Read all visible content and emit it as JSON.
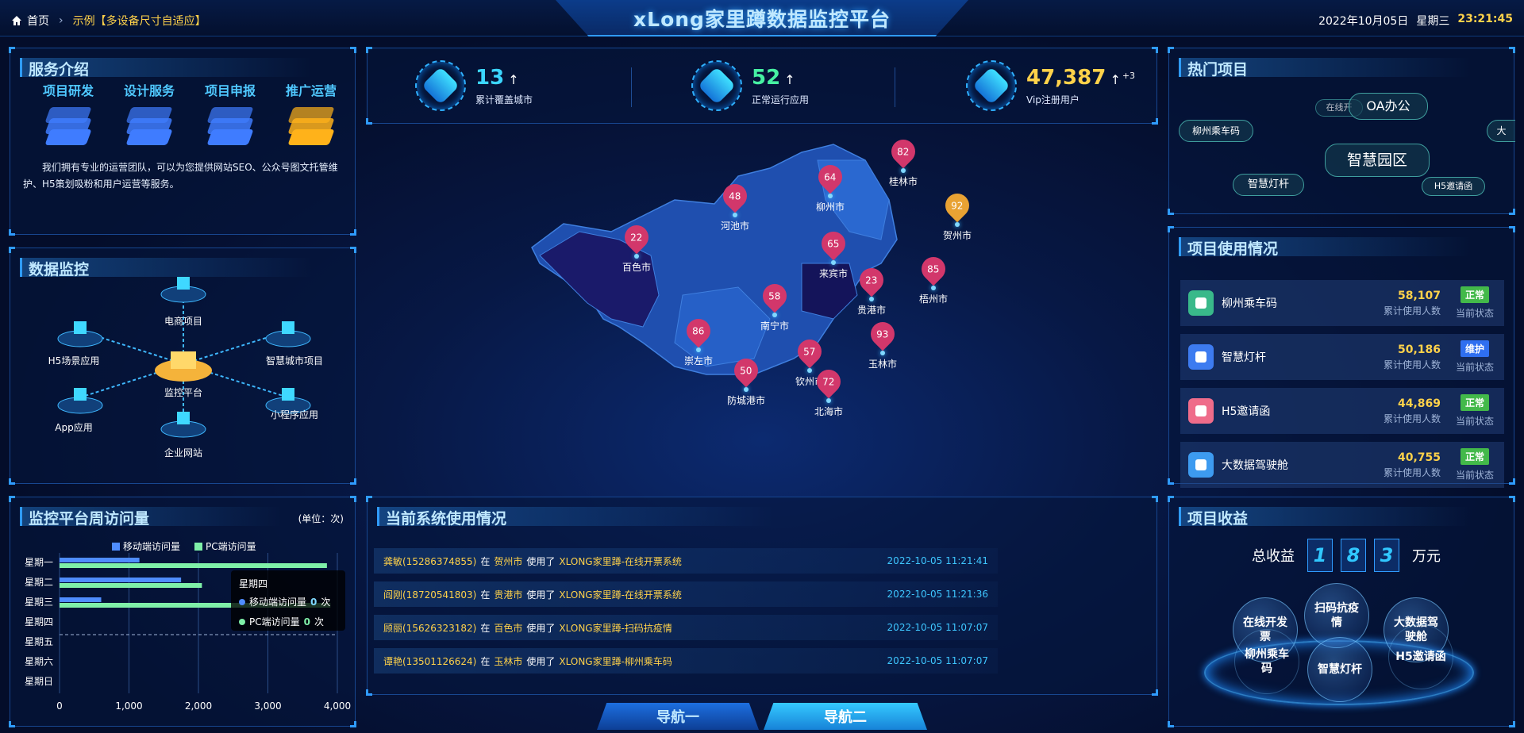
{
  "header": {
    "breadcrumb_home": "首页",
    "breadcrumb_example": "示例【多设备尺寸自适应】",
    "title": "xLong家里蹲数据监控平台",
    "date": "2022年10月05日",
    "weekday": "星期三",
    "time": "23:21:45"
  },
  "services": {
    "title": "服务介绍",
    "items": [
      {
        "label": "项目研发",
        "color": "#3f7cff"
      },
      {
        "label": "设计服务",
        "color": "#3f7cff"
      },
      {
        "label": "项目申报",
        "color": "#3f7cff"
      },
      {
        "label": "推广运营",
        "color": "#ffb21a"
      }
    ],
    "description": "我们拥有专业的运营团队，可以为您提供网站SEO、公众号图文托管维护、H5策划吸粉和用户运营等服务。"
  },
  "monitor": {
    "title": "数据监控",
    "center": "监控平台",
    "nodes": [
      "电商项目",
      "H5场景应用",
      "智慧城市项目",
      "App应用",
      "小程序应用",
      "企业网站"
    ]
  },
  "kpis": [
    {
      "value": "13",
      "arrow": "↑",
      "label": "累计覆盖城市",
      "color": "#3bd6ff",
      "sup": ""
    },
    {
      "value": "52",
      "arrow": "↑",
      "label": "正常运行应用",
      "color": "#46f0a2",
      "sup": ""
    },
    {
      "value": "47,387",
      "arrow": "↑",
      "label": "Vip注册用户",
      "color": "#ffd24a",
      "sup": "+3"
    }
  ],
  "map": {
    "cities": [
      {
        "name": "桂林市",
        "value": "82"
      },
      {
        "name": "柳州市",
        "value": "64"
      },
      {
        "name": "河池市",
        "value": "48"
      },
      {
        "name": "贺州市",
        "value": "92"
      },
      {
        "name": "百色市",
        "value": "22"
      },
      {
        "name": "来宾市",
        "value": "65"
      },
      {
        "name": "梧州市",
        "value": "85"
      },
      {
        "name": "贵港市",
        "value": "23"
      },
      {
        "name": "南宁市",
        "value": "58"
      },
      {
        "name": "玉林市",
        "value": "93"
      },
      {
        "name": "崇左市",
        "value": "86"
      },
      {
        "name": "钦州市",
        "value": "57"
      },
      {
        "name": "防城港市",
        "value": "50"
      },
      {
        "name": "北海市",
        "value": "72"
      }
    ]
  },
  "weekly": {
    "title": "监控平台周访问量",
    "unit": "(单位：次)",
    "chart_data": {
      "type": "bar",
      "orientation": "horizontal",
      "categories": [
        "星期一",
        "星期二",
        "星期三",
        "星期四",
        "星期五",
        "星期六",
        "星期日"
      ],
      "series": [
        {
          "name": "移动端访问量",
          "values": [
            1150,
            1750,
            600,
            0,
            0,
            0,
            0
          ],
          "color": "#4f8dff"
        },
        {
          "name": "PC端访问量",
          "values": [
            3850,
            2050,
            3900,
            0,
            0,
            0,
            0
          ],
          "color": "#7ff0a8"
        }
      ],
      "xticks": [
        "0",
        "1,000",
        "2,000",
        "3,000",
        "4,000"
      ],
      "xlim": [
        0,
        4000
      ],
      "legend": "top"
    },
    "tooltip": {
      "title": "星期四",
      "rows": [
        {
          "name": "移动端访问量",
          "value": "0",
          "unit": "次",
          "color": "#4f8dff"
        },
        {
          "name": "PC端访问量",
          "value": "0",
          "unit": "次",
          "color": "#7ff0a8"
        }
      ]
    }
  },
  "usage": {
    "title": "当前系统使用情况",
    "rows": [
      {
        "user": "龚敏(15286374855)",
        "in": "在",
        "city": "贺州市",
        "used": "使用了",
        "project": "XLONG家里蹲-在线开票系统",
        "date": "2022-10-05 11:21:41"
      },
      {
        "user": "阎刚(18720541803)",
        "in": "在",
        "city": "贵港市",
        "used": "使用了",
        "project": "XLONG家里蹲-在线开票系统",
        "date": "2022-10-05 11:21:36"
      },
      {
        "user": "顾丽(15626323182)",
        "in": "在",
        "city": "百色市",
        "used": "使用了",
        "project": "XLONG家里蹲-扫码抗疫情",
        "date": "2022-10-05 11:07:07"
      },
      {
        "user": "谭艳(13501126624)",
        "in": "在",
        "city": "玉林市",
        "used": "使用了",
        "project": "XLONG家里蹲-柳州乘车码",
        "date": "2022-10-05 11:07:07"
      }
    ]
  },
  "hot": {
    "title": "热门项目",
    "tags": [
      "在线开",
      "OA办公",
      "柳州乘车码",
      "大",
      "智慧园区",
      "智慧灯杆",
      "H5邀请函"
    ]
  },
  "projects": {
    "title": "项目使用情况",
    "value_label": "累计使用人数",
    "status_label": "当前状态",
    "rows": [
      {
        "name": "柳州乘车码",
        "value": "58,107",
        "status": "正常",
        "status_color": "#43b94a",
        "icon_color": "#39b98a"
      },
      {
        "name": "智慧灯杆",
        "value": "50,186",
        "status": "维护",
        "status_color": "#2f6ff0",
        "icon_color": "#3d7bf0"
      },
      {
        "name": "H5邀请函",
        "value": "44,869",
        "status": "正常",
        "status_color": "#43b94a",
        "icon_color": "#ef6c8a"
      },
      {
        "name": "大数据驾驶舱",
        "value": "40,755",
        "status": "正常",
        "status_color": "#43b94a",
        "icon_color": "#3d9bf0"
      }
    ]
  },
  "revenue": {
    "title": "项目收益",
    "label": "总收益",
    "digits": [
      "1",
      "8",
      "3"
    ],
    "unit": "万元",
    "balls": [
      "扫码抗疫情",
      "在线开发票",
      "大数据驾驶舱",
      "柳州乘车码",
      "H5邀请函",
      "智慧灯杆"
    ]
  },
  "nav": {
    "btn1": "导航一",
    "btn2": "导航二"
  }
}
